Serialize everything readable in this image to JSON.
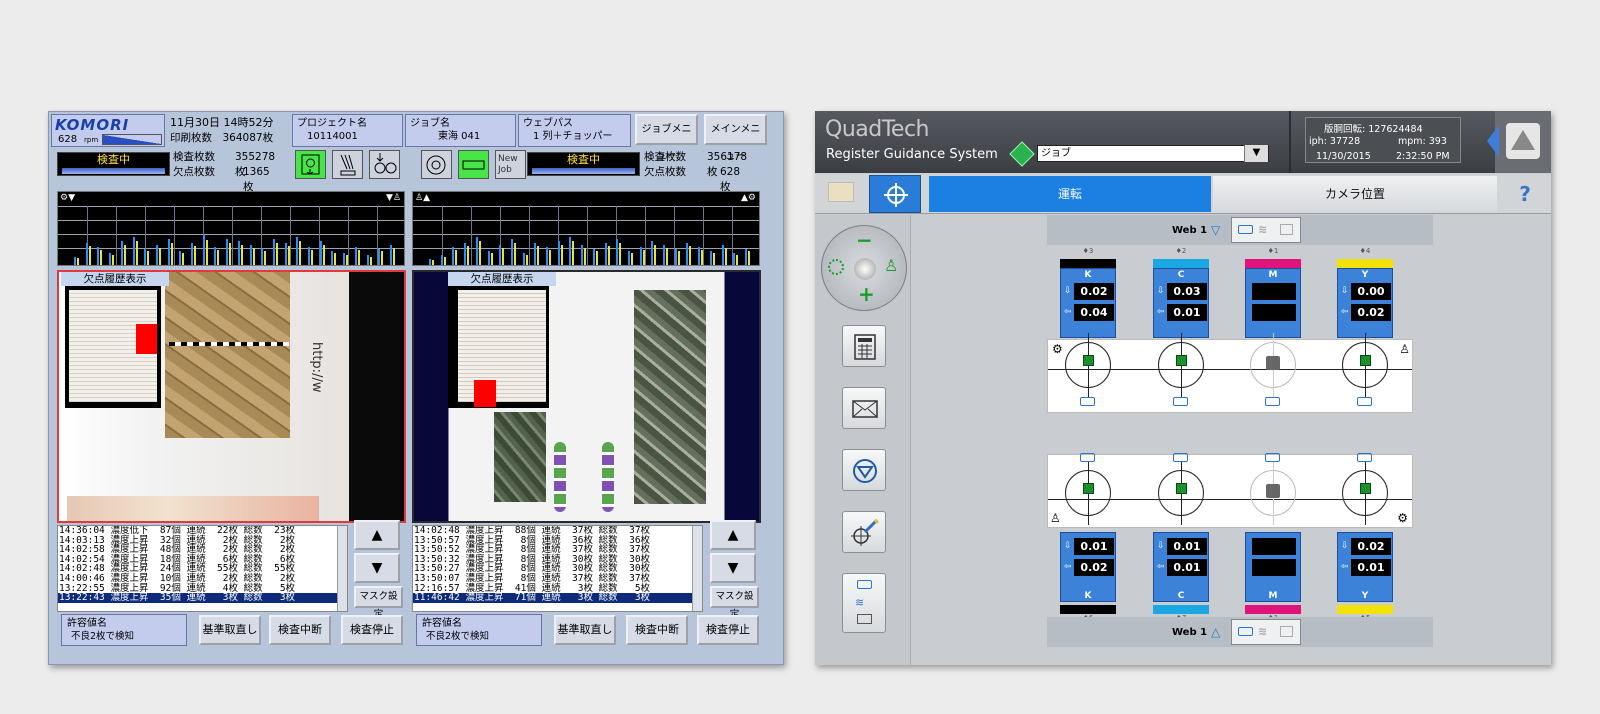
{
  "komori": {
    "logo": "KOMORI",
    "rpm_value": "628",
    "rpm_unit": "rpm",
    "datetime": "11月30日 14時52分",
    "print_count_label": "印刷枚数",
    "print_count_value": "364087枚",
    "project_label": "プロジェクト名",
    "project_value": "10114001",
    "job_label": "ジョブ名",
    "job_value": "東海 041",
    "webpath_label": "ウェブパス",
    "webpath_value": "1 列＋チョッパー",
    "job_menu_btn": "ジョブメニュー",
    "main_menu_btn": "メインメニュー",
    "left": {
      "status": "検査中",
      "inspected_label": "検査枚数",
      "inspected_value": "355278枚",
      "defect_label": "欠点枚数",
      "defect_value": "1365枚",
      "history_label": "欠点履歴表示",
      "log": [
        "14:36:04 濃度低下  87個 連続  22枚 総数  23枚",
        "14:03:13 濃度上昇  32個 連続   2枚 総数   2枚",
        "14:02:58 濃度上昇  48個 連続   2枚 総数   2枚",
        "14:02:54 濃度上昇  18個 連続   6枚 総数   6枚",
        "14:02:48 濃度上昇  24個 連続  55枚 総数  55枚",
        "14:00:46 濃度上昇  10個 連続   2枚 総数   2枚",
        "13:22:55 濃度上昇  92個 連続   4枚 総数   5枚",
        "13:22:43 濃度上昇  35個 連続   3枚 総数   3枚"
      ],
      "mask_btn": "マスク設定",
      "tolerance_label": "許容値名",
      "tolerance_value": "不良2枚で検知",
      "reset_btn": "基準取直し",
      "pause_btn": "検査中断",
      "stop_btn": "検査停止"
    },
    "icon_newjob": "New Job",
    "right": {
      "status": "検査中",
      "inspected_label": "検査枚数",
      "inspected_value": "356178枚",
      "defect_label": "欠点枚数",
      "defect_value": "628枚",
      "history_label": "欠点履歴表示",
      "log": [
        "14:02:48 濃度上昇  88個 連続  37枚 総数  37枚",
        "13:50:57 濃度上昇   8個 連続  36枚 総数  36枚",
        "13:50:52 濃度上昇   8個 連続  37枚 総数  37枚",
        "13:50:32 濃度上昇   8個 連続  30枚 総数  30枚",
        "13:50:27 濃度上昇   8個 連続  30枚 総数  30枚",
        "13:50:07 濃度上昇   8個 連続  37枚 総数  37枚",
        "12:16:57 濃度上昇  41個 連続   3枚 総数   5枚",
        "11:46:42 濃度上昇  71個 連続   3枚 総数   3枚"
      ],
      "mask_btn": "マスク設定",
      "tolerance_label": "許容値名",
      "tolerance_value": "不良2枚で検知",
      "reset_btn": "基準取直し",
      "pause_btn": "検査中断",
      "stop_btn": "検査停止"
    },
    "arrow_up": "▲",
    "arrow_down": "▼"
  },
  "quad": {
    "brand": "QuadTech",
    "subtitle": "Register Guidance System",
    "job_select": "ジョブ",
    "counter_label": "版胴回転:",
    "counter_value": "127624484",
    "iph": "iph:  37728",
    "mpm": "mpm:  393",
    "date": "11/30/2015",
    "time": "2:32:50 PM",
    "tab_run": "運転",
    "tab_camera": "カメラ位置",
    "help": "?",
    "web_top": "Web 1",
    "web_bottom": "Web 1",
    "top_units": [
      {
        "num": "3",
        "color": "K",
        "v1": "0.02",
        "v2": "0.04",
        "strip": "#000000"
      },
      {
        "num": "2",
        "color": "C",
        "v1": "0.03",
        "v2": "0.01",
        "strip": "#1aa8e4"
      },
      {
        "num": "1",
        "color": "M",
        "v1": "",
        "v2": "",
        "strip": "#e0127c"
      },
      {
        "num": "4",
        "color": "Y",
        "v1": "0.00",
        "v2": "0.02",
        "strip": "#f2e20a"
      }
    ],
    "bottom_units": [
      {
        "num": "6",
        "color": "K",
        "v1": "0.01",
        "v2": "0.02",
        "strip": "#000000"
      },
      {
        "num": "7",
        "color": "C",
        "v1": "0.01",
        "v2": "0.01",
        "strip": "#1aa8e4"
      },
      {
        "num": "1",
        "color": "M",
        "v1": "",
        "v2": "",
        "strip": "#e0127c"
      },
      {
        "num": "5",
        "color": "Y",
        "v1": "0.02",
        "v2": "0.01",
        "strip": "#f2e20a"
      }
    ],
    "minus": "−",
    "plus": "+"
  }
}
